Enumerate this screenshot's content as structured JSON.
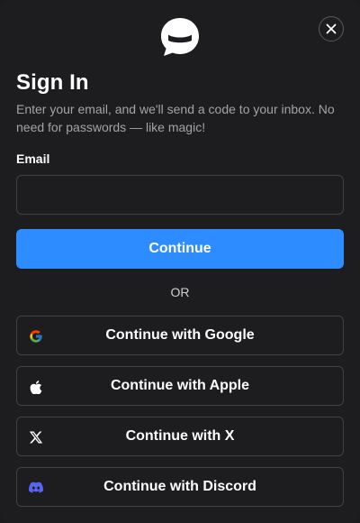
{
  "dialog": {
    "title": "Sign In",
    "subtitle": "Enter your email, and we'll send a code to your inbox. No need for passwords — like magic!",
    "email_label": "Email",
    "email_value": "",
    "continue_label": "Continue",
    "separator": "OR"
  },
  "social_buttons": [
    {
      "label": "Continue with Google",
      "icon": "google-icon"
    },
    {
      "label": "Continue with Apple",
      "icon": "apple-icon"
    },
    {
      "label": "Continue with X",
      "icon": "x-icon"
    },
    {
      "label": "Continue with Discord",
      "icon": "discord-icon"
    }
  ],
  "colors": {
    "background": "#1d1d1f",
    "primary": "#2d8cff",
    "border": "#414145",
    "muted_text": "#a4a4a8",
    "discord": "#5865f2"
  }
}
